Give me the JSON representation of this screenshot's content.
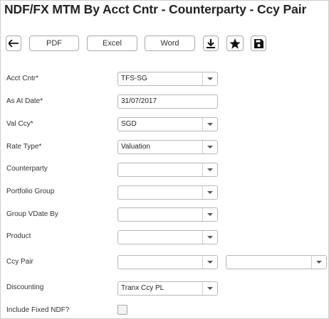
{
  "page": {
    "title": "NDF/FX MTM By Acct Cntr - Counterparty - Ccy Pair"
  },
  "toolbar": {
    "back_icon": "arrow-left-icon",
    "pdf_label": "PDF",
    "excel_label": "Excel",
    "word_label": "Word",
    "download_icon": "download-icon",
    "favorite_icon": "star-icon",
    "save_icon": "floppy-disk-icon"
  },
  "form": {
    "acct_cntr": {
      "label": "Acct Cntr*",
      "value": "TFS-SG"
    },
    "as_at_date": {
      "label": "As At Date*",
      "value": "31/07/2017"
    },
    "val_ccy": {
      "label": "Val Ccy*",
      "value": "SGD"
    },
    "rate_type": {
      "label": "Rate Type*",
      "value": "Valuation"
    },
    "counterparty": {
      "label": "Counterparty",
      "value": ""
    },
    "portfolio_group": {
      "label": "Portfolio Group",
      "value": ""
    },
    "group_vdate_by": {
      "label": "Group VDate By",
      "value": ""
    },
    "product": {
      "label": "Product",
      "value": ""
    },
    "ccy_pair": {
      "label": "Ccy Pair",
      "value_1": "",
      "value_2": ""
    },
    "discounting": {
      "label": "Discounting",
      "value": "Tranx Ccy PL"
    },
    "include_fixed_ndf": {
      "label": "Include Fixed NDF?",
      "checked": false
    }
  }
}
